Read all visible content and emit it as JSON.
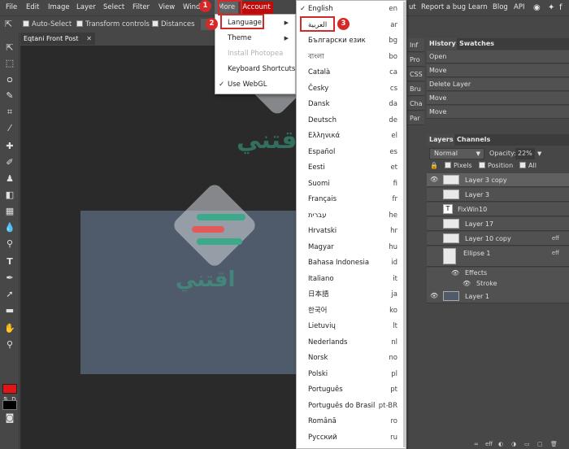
{
  "menubar": {
    "items": [
      "File",
      "Edit",
      "Image",
      "Layer",
      "Select",
      "Filter",
      "View",
      "Wind",
      "More"
    ],
    "account_label": "Account",
    "right_items": [
      "ut",
      "Report a bug",
      "Learn",
      "Blog",
      "API"
    ]
  },
  "options_bar": {
    "auto_select": "Auto-Select",
    "transform_controls": "Transform controls",
    "distances": "Distances"
  },
  "document": {
    "tab_title": "Eqtani Front Post",
    "close_glyph": "✕"
  },
  "more_menu": {
    "items": [
      {
        "label": "Language",
        "has_submenu": true,
        "disabled": false,
        "checked": false
      },
      {
        "label": "Theme",
        "has_submenu": true,
        "disabled": false,
        "checked": false
      },
      {
        "label": "Install Photopea",
        "has_submenu": false,
        "disabled": true,
        "checked": false
      },
      {
        "label": "Keyboard Shortcuts",
        "has_submenu": false,
        "disabled": false,
        "checked": false
      },
      {
        "label": "Use WebGL",
        "has_submenu": false,
        "disabled": false,
        "checked": true
      }
    ]
  },
  "language_menu": {
    "items": [
      {
        "name": "English",
        "code": "en",
        "checked": true
      },
      {
        "name": "العربية",
        "code": "ar"
      },
      {
        "name": "Български език",
        "code": "bg"
      },
      {
        "name": "বাংলা",
        "code": "bo"
      },
      {
        "name": "Català",
        "code": "ca"
      },
      {
        "name": "Česky",
        "code": "cs"
      },
      {
        "name": "Dansk",
        "code": "da"
      },
      {
        "name": "Deutsch",
        "code": "de"
      },
      {
        "name": "Ελληνικά",
        "code": "el"
      },
      {
        "name": "Español",
        "code": "es"
      },
      {
        "name": "Eesti",
        "code": "et"
      },
      {
        "name": "Suomi",
        "code": "fi"
      },
      {
        "name": "Français",
        "code": "fr"
      },
      {
        "name": "עברית",
        "code": "he"
      },
      {
        "name": "Hrvatski",
        "code": "hr"
      },
      {
        "name": "Magyar",
        "code": "hu"
      },
      {
        "name": "Bahasa Indonesia",
        "code": "id"
      },
      {
        "name": "Italiano",
        "code": "it"
      },
      {
        "name": "日本語",
        "code": "ja"
      },
      {
        "name": "한국어",
        "code": "ko"
      },
      {
        "name": "Lietuvių",
        "code": "lt"
      },
      {
        "name": "Nederlands",
        "code": "nl"
      },
      {
        "name": "Norsk",
        "code": "no"
      },
      {
        "name": "Polski",
        "code": "pl"
      },
      {
        "name": "Português",
        "code": "pt"
      },
      {
        "name": "Português do Brasil",
        "code": "pt-BR"
      },
      {
        "name": "Română",
        "code": "ro"
      },
      {
        "name": "Русский",
        "code": "ru"
      }
    ]
  },
  "mini_panel": [
    "Inf",
    "Pro",
    "CSS",
    "Bru",
    "Cha",
    "Par"
  ],
  "history_panel": {
    "tabs": [
      "History",
      "Swatches"
    ],
    "items": [
      "Open",
      "Move",
      "Delete Layer",
      "Move",
      "Move"
    ]
  },
  "layers_panel": {
    "tabs": [
      "Layers",
      "Channels"
    ],
    "blend_mode": "Normal",
    "opacity_label": "Opacity:",
    "opacity_value": "22%",
    "lock_label": "🔒",
    "lock_pixels": "Pixels",
    "lock_position": "Position",
    "lock_all": "All",
    "layers": [
      {
        "name": "Layer 3 copy",
        "visible": true,
        "eff": ""
      },
      {
        "name": "Layer 3",
        "visible": false,
        "eff": ""
      },
      {
        "name": "FixWin10",
        "visible": false,
        "eff": ""
      },
      {
        "name": "Layer 17",
        "visible": false,
        "eff": ""
      },
      {
        "name": "Layer 10 copy",
        "visible": false,
        "eff": "eff"
      },
      {
        "name": "Ellipse 1",
        "visible": false,
        "eff": "eff"
      }
    ],
    "effects_label": "Effects",
    "stroke_label": "Stroke",
    "bottom_layer": "Layer 1",
    "footer_eff": "eff"
  },
  "watermark_text": "اقتني",
  "annotations": [
    "1",
    "2",
    "3"
  ],
  "colors": {
    "account": "#c10b0b",
    "foreground_color": "#e21414",
    "background_color": "#000000",
    "highlight": "#d12a2a"
  }
}
